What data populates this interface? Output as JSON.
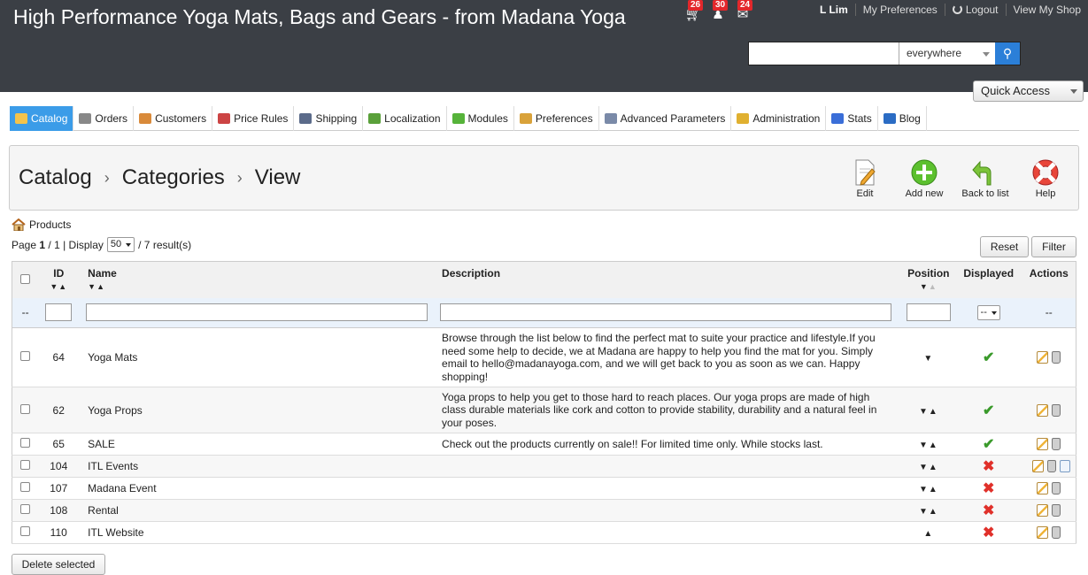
{
  "header": {
    "shop_title": "High Performance Yoga Mats, Bags and Gears - from Madana Yoga",
    "notifications": [
      {
        "icon": "cart-icon",
        "count": "26"
      },
      {
        "icon": "customer-icon",
        "count": "30"
      },
      {
        "icon": "message-icon",
        "count": "24"
      }
    ],
    "user_name": "L Lim",
    "my_preferences": "My Preferences",
    "logout": "Logout",
    "view_shop": "View My Shop",
    "search_placeholder": "",
    "search_scope": "everywhere",
    "quick_access": "Quick Access"
  },
  "tabs": [
    {
      "label": "Catalog",
      "icon": "folder-icon",
      "color": "#f3c34b",
      "active": true
    },
    {
      "label": "Orders",
      "icon": "cart-icon",
      "color": "#888888"
    },
    {
      "label": "Customers",
      "icon": "customer-icon",
      "color": "#d98a3a"
    },
    {
      "label": "Price Rules",
      "icon": "price-icon",
      "color": "#cc4444"
    },
    {
      "label": "Shipping",
      "icon": "truck-icon",
      "color": "#5b6b8a"
    },
    {
      "label": "Localization",
      "icon": "globe-icon",
      "color": "#5aa03a"
    },
    {
      "label": "Modules",
      "icon": "puzzle-icon",
      "color": "#56b33a"
    },
    {
      "label": "Preferences",
      "icon": "preferences-icon",
      "color": "#d9a23a"
    },
    {
      "label": "Advanced Parameters",
      "icon": "wrench-icon",
      "color": "#7a8aa8"
    },
    {
      "label": "Administration",
      "icon": "key-icon",
      "color": "#e0b030"
    },
    {
      "label": "Stats",
      "icon": "chart-icon",
      "color": "#3a6ed8"
    },
    {
      "label": "Blog",
      "icon": "speech-bubble-icon",
      "color": "#2b6cc4"
    }
  ],
  "breadcrumb": [
    "Catalog",
    "Categories",
    "View"
  ],
  "breadcrumb_sep": "›",
  "toolbar": {
    "edit": "Edit",
    "add_new": "Add new",
    "back_to_list": "Back to list",
    "help": "Help"
  },
  "list": {
    "products_link": "Products",
    "page_label": "Page",
    "page_current": "1",
    "page_total": "/ 1 | Display",
    "display_value": "50",
    "results": "/ 7 result(s)",
    "reset": "Reset",
    "filter": "Filter",
    "delete_selected": "Delete selected"
  },
  "table": {
    "columns": {
      "id": "ID",
      "name": "Name",
      "description": "Description",
      "position": "Position",
      "displayed": "Displayed",
      "actions": "Actions"
    },
    "filter_row": {
      "left": "--",
      "displayed_select": "--",
      "actions": "--"
    },
    "rows": [
      {
        "id": "64",
        "name": "Yoga Mats",
        "description": "Browse through the list below to find the perfect mat to suite your practice and lifestyle.If you need some help to decide, we at Madana are happy to help you find the mat for you. Simply email to hello@madanayoga.com, and we will get back to you as soon as we can. Happy shopping!",
        "position": "▼",
        "displayed": true,
        "view": false
      },
      {
        "id": "62",
        "name": "Yoga Props",
        "description": "Yoga props to help you get to those hard to reach places. Our yoga props are made of high class durable materials like cork and cotton to provide stability, durability and a natural feel in your poses.",
        "position": "▼▲",
        "displayed": true,
        "view": false
      },
      {
        "id": "65",
        "name": "SALE",
        "description": "Check out the products currently on sale!! For limited time only. While stocks last.",
        "position": "▼▲",
        "displayed": true,
        "view": false
      },
      {
        "id": "104",
        "name": "ITL Events",
        "description": "",
        "position": "▼▲",
        "displayed": false,
        "view": true
      },
      {
        "id": "107",
        "name": "Madana Event",
        "description": "",
        "position": "▼▲",
        "displayed": false,
        "view": false
      },
      {
        "id": "108",
        "name": "Rental",
        "description": "",
        "position": "▼▲",
        "displayed": false,
        "view": false
      },
      {
        "id": "110",
        "name": "ITL Website",
        "description": "",
        "position": "▲",
        "displayed": false,
        "view": false
      }
    ]
  }
}
